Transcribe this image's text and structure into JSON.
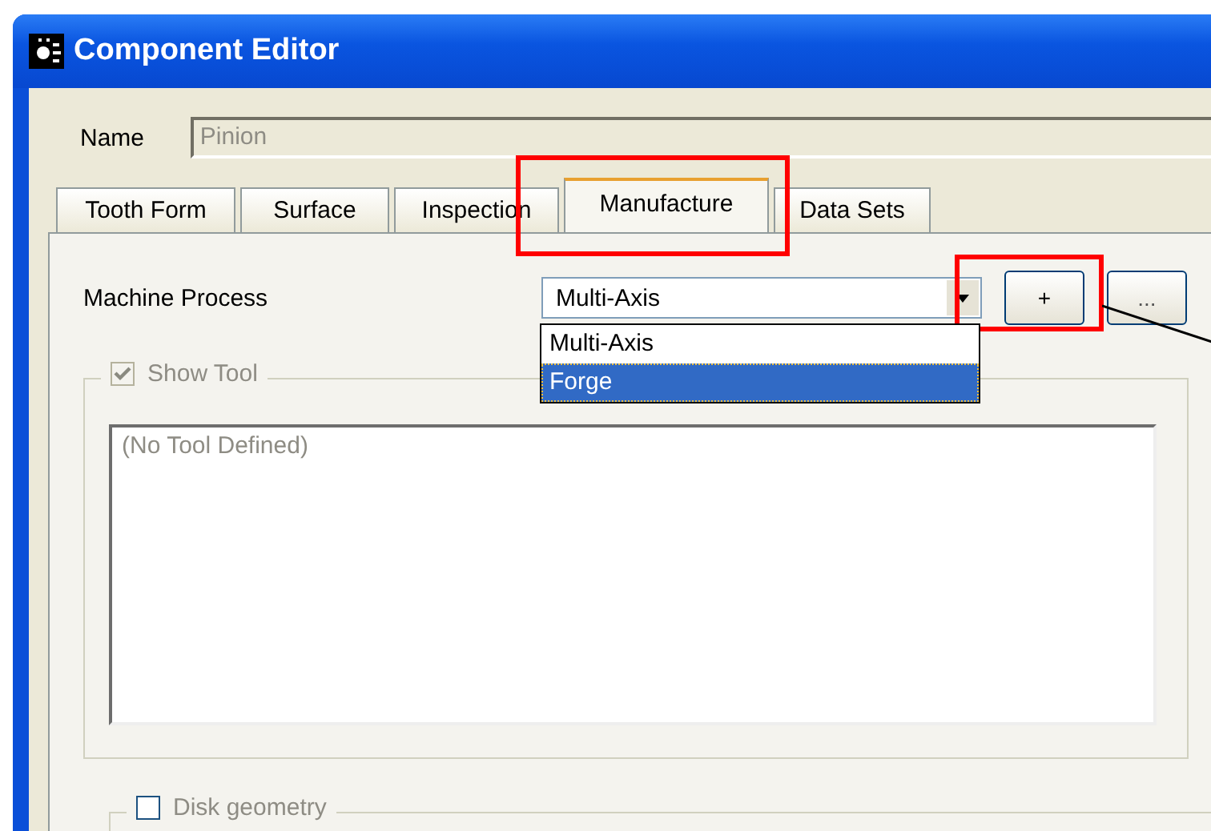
{
  "window": {
    "title": "Component Editor"
  },
  "name_field": {
    "label": "Name",
    "value": "Pinion",
    "disabled": true
  },
  "tabs": [
    {
      "label": "Tooth Form",
      "selected": false
    },
    {
      "label": "Surface",
      "selected": false
    },
    {
      "label": "Inspection",
      "selected": false
    },
    {
      "label": "Manufacture",
      "selected": true
    },
    {
      "label": "Data Sets",
      "selected": false
    }
  ],
  "machine_process": {
    "label": "Machine Process",
    "value": "Multi-Axis",
    "options": [
      {
        "label": "Multi-Axis",
        "highlighted": false
      },
      {
        "label": "Forge",
        "highlighted": true
      }
    ]
  },
  "buttons": [
    "+",
    "..."
  ],
  "show_tool": {
    "label": "Show Tool",
    "checked": true,
    "disabled": true
  },
  "tool_text": "(No Tool Defined)",
  "disk_geometry": {
    "label": "Disk geometry",
    "checked": false
  }
}
